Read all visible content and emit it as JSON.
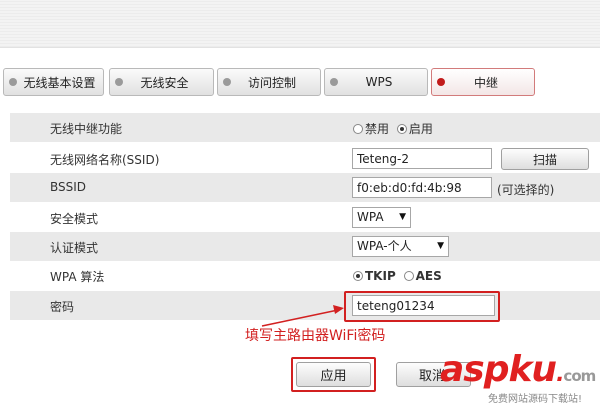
{
  "tabs": [
    {
      "label": "无线基本设置",
      "active": false
    },
    {
      "label": "无线安全",
      "active": false
    },
    {
      "label": "访问控制",
      "active": false
    },
    {
      "label": "WPS",
      "active": false
    },
    {
      "label": "中继",
      "active": true
    }
  ],
  "form": {
    "repeater": {
      "label": "无线中继功能",
      "option_disable": "禁用",
      "option_enable": "启用",
      "selected": "启用"
    },
    "ssid": {
      "label": "无线网络名称(SSID)",
      "value": "Teteng-2",
      "scan_button": "扫描"
    },
    "bssid": {
      "label": "BSSID",
      "value": "f0:eb:d0:fd:4b:98",
      "hint": "(可选择的)"
    },
    "security_mode": {
      "label": "安全模式",
      "value": "WPA",
      "arrow": "▼"
    },
    "auth_mode": {
      "label": "认证模式",
      "value": "WPA-个人",
      "arrow": "▼"
    },
    "wpa_algorithm": {
      "label": "WPA 算法",
      "option_tkip": "TKIP",
      "option_aes": "AES",
      "selected": "TKIP"
    },
    "password": {
      "label": "密码",
      "value": "teteng01234"
    }
  },
  "annotation": "填写主路由器WiFi密码",
  "buttons": {
    "apply": "应用",
    "cancel": "取消"
  },
  "watermark": {
    "logo": "aspku",
    "dot": ".",
    "com": "com",
    "sub": "免费网站源码下载站!"
  },
  "colors": {
    "accent_red": "#d22020",
    "row_shade": "#e9e9e9"
  }
}
